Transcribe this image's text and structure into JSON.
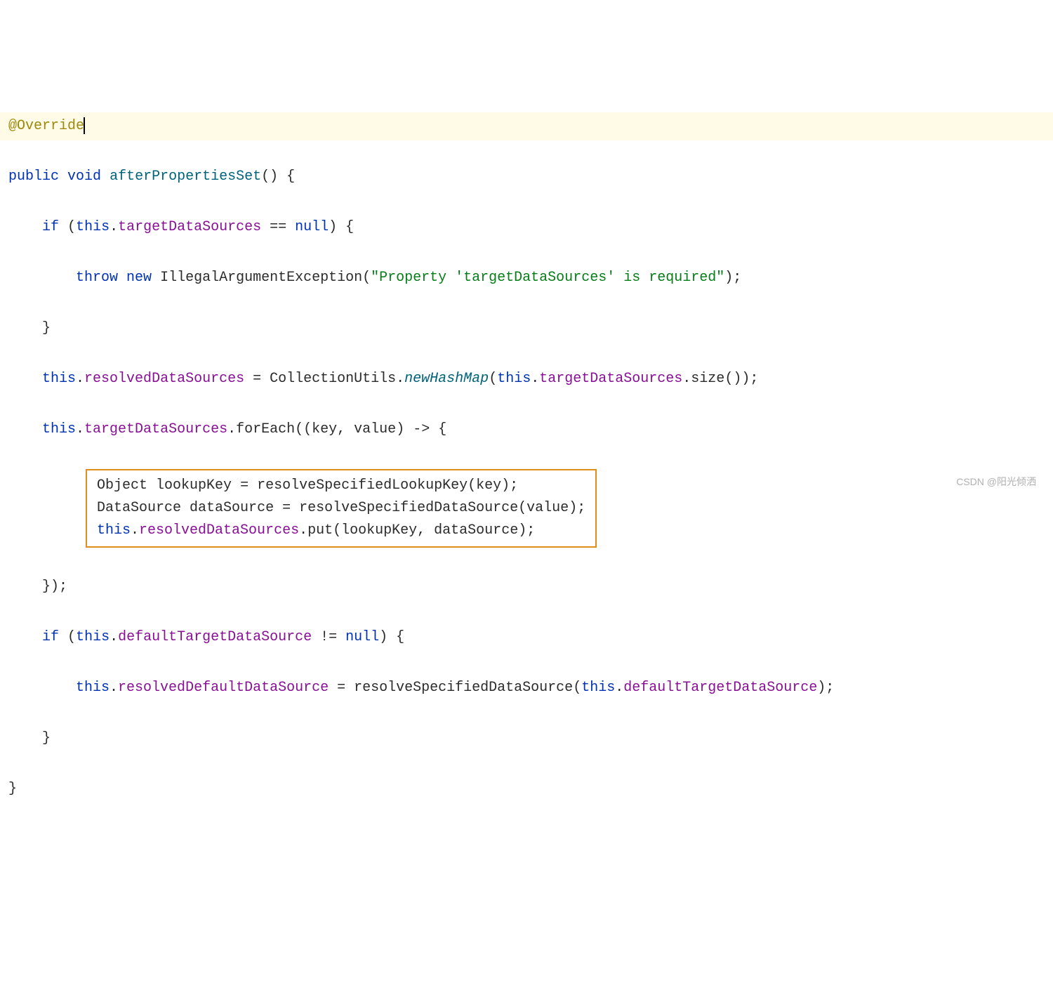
{
  "code": {
    "annotation": "@Override",
    "kw_public": "public",
    "kw_void": "void",
    "method_name": "afterPropertiesSet",
    "kw_if": "if",
    "kw_this": "this",
    "field_targetDataSources": "targetDataSources",
    "kw_null": "null",
    "kw_throw": "throw",
    "kw_new": "new",
    "exception_class": "IllegalArgumentException",
    "exception_msg": "\"Property 'targetDataSources' is required\"",
    "field_resolvedDataSources": "resolvedDataSources",
    "class_CollectionUtils": "CollectionUtils",
    "method_newHashMap": "newHashMap",
    "method_size": "size",
    "method_forEach": "forEach",
    "param_key": "key",
    "param_value": "value",
    "type_Object": "Object",
    "var_lookupKey": "lookupKey",
    "method_resolveSpecifiedLookupKey": "resolveSpecifiedLookupKey",
    "type_DataSource": "DataSource",
    "var_dataSource": "dataSource",
    "method_resolveSpecifiedDataSource": "resolveSpecifiedDataSource",
    "method_put": "put",
    "field_defaultTargetDataSource": "defaultTargetDataSource",
    "field_resolvedDefaultDataSource": "resolvedDefaultDataSource"
  },
  "watermark": "CSDN @阳光倾洒"
}
